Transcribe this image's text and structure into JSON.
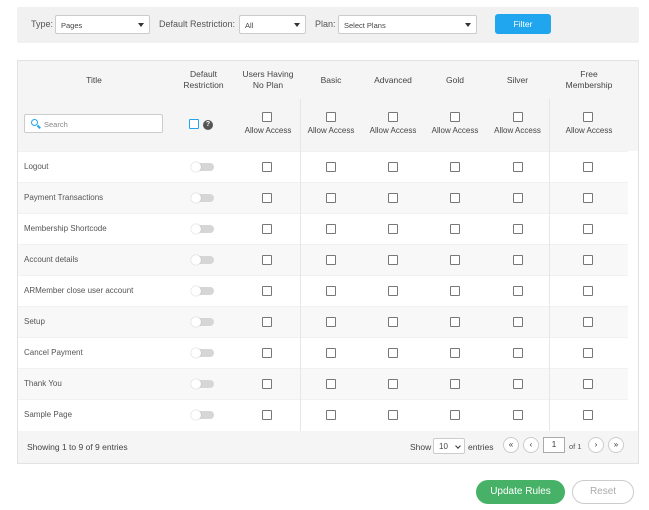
{
  "filters": {
    "type_label": "Type:",
    "type_value": "Pages",
    "restriction_label": "Default Restriction:",
    "restriction_value": "All",
    "plan_label": "Plan:",
    "plan_value": "Select Plans",
    "filter_button": "Filter"
  },
  "table": {
    "columns": [
      "Title",
      "Default Restriction",
      "Users Having No Plan",
      "Basic",
      "Advanced",
      "Gold",
      "Silver",
      "Free Membership"
    ],
    "search_placeholder": "Search",
    "allow_access_label": "Allow Access",
    "help_glyph": "?",
    "rows": [
      {
        "title": "Logout"
      },
      {
        "title": "Payment Transactions"
      },
      {
        "title": "Membership Shortcode"
      },
      {
        "title": "Account details"
      },
      {
        "title": "ARMember close user account"
      },
      {
        "title": "Setup"
      },
      {
        "title": "Cancel Payment"
      },
      {
        "title": "Thank You"
      },
      {
        "title": "Sample Page"
      }
    ]
  },
  "footer": {
    "showing_text": "Showing 1 to 9 of 9 entries",
    "show_label": "Show",
    "page_length": "10",
    "entries_label": "entries",
    "first_glyph": "«",
    "prev_glyph": "‹",
    "current_page": "1",
    "of_label": "of 1",
    "next_glyph": "›",
    "last_glyph": "»"
  },
  "actions": {
    "update_label": "Update Rules",
    "reset_label": "Reset"
  },
  "colors": {
    "accent_blue": "#1fa6ef",
    "update_green": "#47b267",
    "toggle_off": "#d6d6d6"
  }
}
